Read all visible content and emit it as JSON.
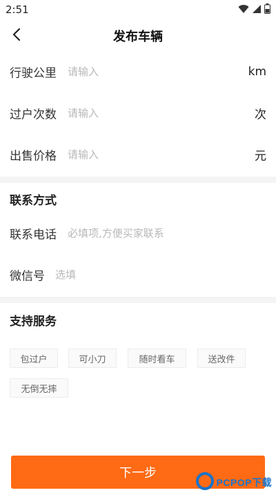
{
  "status_bar": {
    "time": "2:51",
    "icons": [
      "wifi-icon",
      "signal-icon",
      "battery-icon"
    ]
  },
  "nav": {
    "title": "发布车辆",
    "back_icon": "chevron-left-icon"
  },
  "vehicle_fields": [
    {
      "label": "行驶公里",
      "placeholder": "请输入",
      "value": "",
      "unit": "km"
    },
    {
      "label": "过户次数",
      "placeholder": "请输入",
      "value": "",
      "unit": "次"
    },
    {
      "label": "出售价格",
      "placeholder": "请输入",
      "value": "",
      "unit": "元"
    }
  ],
  "contact": {
    "section_title": "联系方式",
    "phone": {
      "label": "联系电话",
      "placeholder": "必填项,方便买家联系",
      "value": ""
    },
    "wechat": {
      "label": "微信号",
      "placeholder": "选填",
      "value": ""
    }
  },
  "services": {
    "section_title": "支持服务",
    "tags": [
      "包过户",
      "可小刀",
      "随时看车",
      "送改件",
      "无倒无摔"
    ]
  },
  "next_button": {
    "label": "下一步"
  },
  "watermark": {
    "text": "PCPOP下载"
  },
  "colors": {
    "accent": "#ff6a14",
    "divider": "#f4f4f4",
    "placeholder": "#b8b8b8",
    "watermark": "#1a73c9"
  }
}
